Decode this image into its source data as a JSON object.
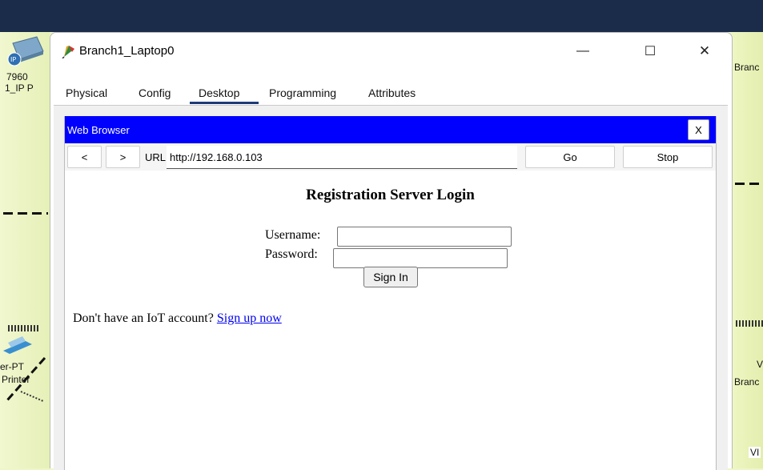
{
  "workspace": {
    "left_labels": [
      "7960",
      "1_IP P",
      "er-PT",
      "Printer"
    ],
    "right_labels": [
      "Branc",
      "V",
      "Branc",
      "VI"
    ]
  },
  "window": {
    "title": "Branch1_Laptop0",
    "controls": {
      "minimize": "—",
      "maximize": "☐",
      "close": "✕"
    }
  },
  "tabs": [
    {
      "label": "Physical"
    },
    {
      "label": "Config"
    },
    {
      "label": "Desktop",
      "active": true
    },
    {
      "label": "Programming"
    },
    {
      "label": "Attributes"
    }
  ],
  "browser": {
    "title": "Web Browser",
    "close_label": "X",
    "back_label": "<",
    "forward_label": ">",
    "url_label": "URL",
    "url_value": "http://192.168.0.103",
    "go_label": "Go",
    "stop_label": "Stop"
  },
  "page": {
    "heading": "Registration Server Login",
    "username_label": "Username:",
    "username_value": "",
    "password_label": "Password:",
    "password_value": "",
    "signin_label": "Sign In",
    "signup_prompt": "Don't have an IoT account?",
    "signup_link": "Sign up now"
  },
  "colors": {
    "browser_titlebar": "#0000ff",
    "link": "#0000ee",
    "active_tab_underline": "#1f3a78",
    "workspace_bg": "#eef6c8",
    "top_bar": "#1a2c4a"
  }
}
